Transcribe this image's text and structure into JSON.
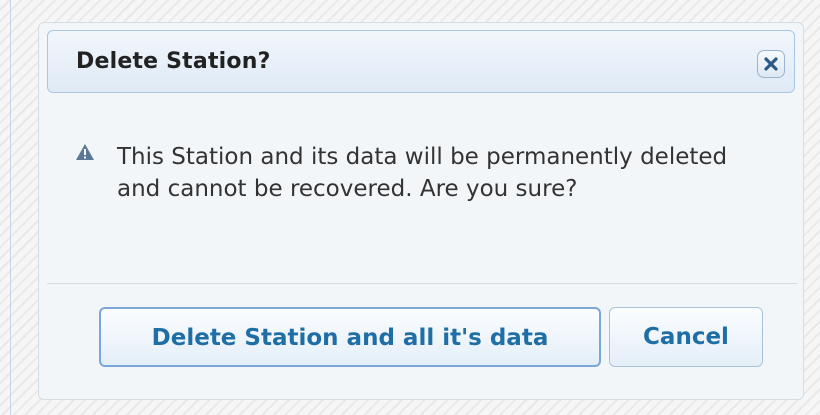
{
  "dialog": {
    "title": "Delete Station?",
    "close_icon": "close-icon",
    "warning_icon": "warning-triangle-icon",
    "message": "This Station and its data will be permanently deleted and cannot be recovered. Are you sure?",
    "buttons": {
      "confirm_label": "Delete Station and all it's data",
      "cancel_label": "Cancel"
    }
  },
  "colors": {
    "accent": "#1f6fa6",
    "titlebar_border": "#a9c6e4",
    "warning_icon": "#5a7896"
  }
}
